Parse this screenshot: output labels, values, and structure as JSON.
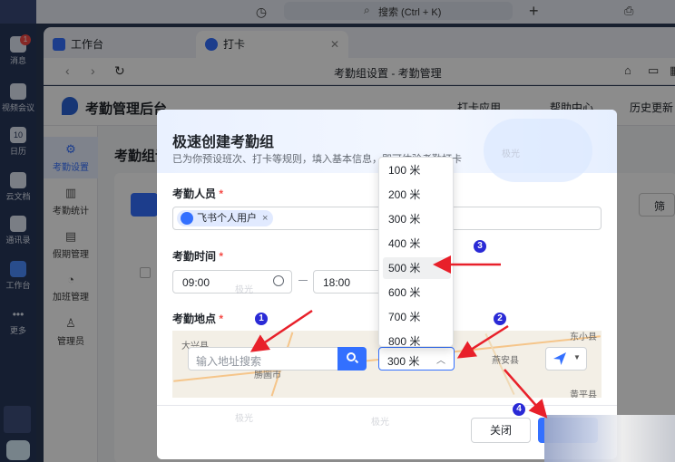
{
  "topbar": {
    "search_label": "搜索 (Ctrl + K)"
  },
  "rail": {
    "badge": "1",
    "items": [
      {
        "label": "消息"
      },
      {
        "label": "视频会议"
      },
      {
        "label": "日历"
      },
      {
        "label": "云文档"
      },
      {
        "label": "通讯录"
      },
      {
        "label": "工作台"
      },
      {
        "label": "更多"
      }
    ],
    "calendar_day": "10"
  },
  "tabs": [
    {
      "label": "工作台"
    },
    {
      "label": "打卡"
    }
  ],
  "address": {
    "page_title": "考勤组设置 - 考勤管理"
  },
  "app": {
    "title": "考勤管理后台",
    "header_links": [
      "打卡应用",
      "帮助中心",
      "历史更新"
    ],
    "side_items": [
      "考勤设置",
      "考勤统计",
      "假期管理",
      "加班管理",
      "管理员"
    ],
    "content_title": "考勤组设",
    "filter_label": "筛"
  },
  "modal": {
    "title": "极速创建考勤组",
    "subtitle": "已为你预设班次、打卡等规则，填入基本信息，即可体验考勤打卡",
    "members_label": "考勤人员",
    "member_tag": "飞书个人用户",
    "time_label": "考勤时间",
    "start_time": "09:00",
    "end_time": "18:00",
    "location_label": "考勤地点",
    "address_placeholder": "输入地址搜索",
    "radius_value": "300 米",
    "map_labels": [
      "大兴县",
      "勝圖市",
      "燕安县",
      "黄平县",
      "东小县"
    ],
    "close_label": "关闭",
    "watermark": "极光"
  },
  "dropdown": {
    "options": [
      "100 米",
      "200 米",
      "300 米",
      "400 米",
      "500 米",
      "600 米",
      "700 米",
      "800 米"
    ],
    "selected": "500 米"
  },
  "annotations": [
    "1",
    "2",
    "3",
    "4"
  ],
  "colors": {
    "accent": "#3370ff",
    "arrow": "#e8202a",
    "step_badge": "#2a2ad6"
  }
}
